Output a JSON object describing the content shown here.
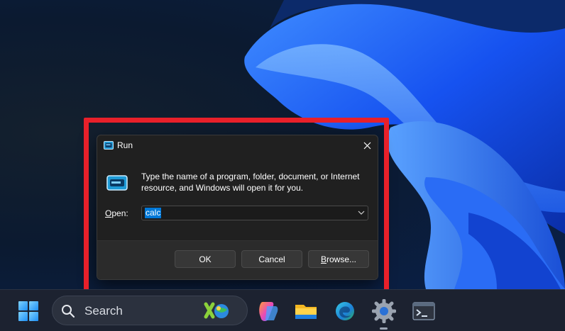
{
  "dialog": {
    "title": "Run",
    "description": "Type the name of a program, folder, document, or Internet resource, and Windows will open it for you.",
    "open_label": "Open:",
    "open_value": "calc",
    "buttons": {
      "ok": "OK",
      "cancel": "Cancel",
      "browse": "Browse..."
    }
  },
  "taskbar": {
    "search_placeholder": "Search",
    "apps": [
      "widgets-icon",
      "copilot-icon",
      "file-explorer-icon",
      "edge-icon",
      "settings-icon",
      "terminal-icon"
    ]
  },
  "colors": {
    "highlight": "#e8202a",
    "selection": "#0078d7",
    "dialog_bg": "#202020",
    "footer_bg": "#2b2b2b"
  }
}
